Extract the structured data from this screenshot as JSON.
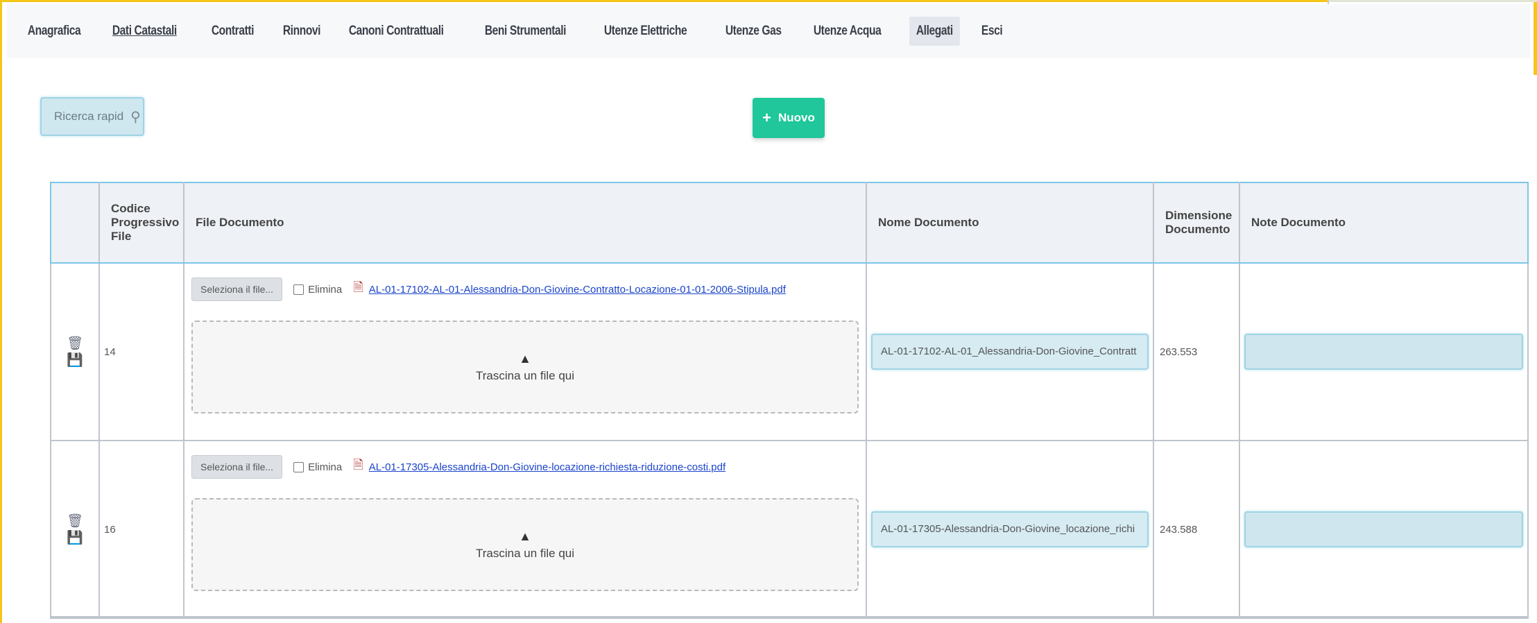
{
  "tabs": [
    {
      "label": "Anagrafica",
      "underline": false,
      "active": false
    },
    {
      "label": "Dati Catastali",
      "underline": true,
      "active": false
    },
    {
      "label": "Contratti",
      "underline": false,
      "active": false
    },
    {
      "label": "Rinnovi",
      "underline": false,
      "active": false
    },
    {
      "label": "Canoni Contrattuali",
      "underline": false,
      "active": false
    },
    {
      "label": "Beni Strumentali",
      "underline": false,
      "active": false
    },
    {
      "label": "Utenze Elettriche",
      "underline": false,
      "active": false
    },
    {
      "label": "Utenze Gas",
      "underline": false,
      "active": false
    },
    {
      "label": "Utenze Acqua",
      "underline": false,
      "active": false
    },
    {
      "label": "Allegati",
      "underline": false,
      "active": true
    },
    {
      "label": "Esci",
      "underline": false,
      "active": false
    }
  ],
  "search": {
    "placeholder": "Ricerca rapid"
  },
  "toolbar": {
    "new_label": "Nuovo"
  },
  "table": {
    "headers": [
      "",
      "Codice Progressivo File",
      "File Documento",
      "Nome Documento",
      "Dimensione Documento",
      "Note Documento"
    ],
    "rows": [
      {
        "code": "14",
        "select_label": "Seleziona il file...",
        "delete_label": "Elimina",
        "file_link": "AL-01-17102-AL-01-Alessandria-Don-Giovine-Contratto-Locazione-01-01-2006-Stipula.pdf",
        "drop_label": "Trascina un file qui",
        "name": "AL-01-17102-AL-01_Alessandria-Don-Giovine_Contratt",
        "size": "263.553",
        "note": ""
      },
      {
        "code": "16",
        "select_label": "Seleziona il file...",
        "delete_label": "Elimina",
        "file_link": "AL-01-17305-Alessandria-Don-Giovine-locazione-richiesta-riduzione-costi.pdf",
        "drop_label": "Trascina un file qui",
        "name": "AL-01-17305-Alessandria-Don-Giovine_locazione_richi",
        "size": "243.588",
        "note": ""
      }
    ]
  },
  "icons": {
    "search": "search-icon",
    "plus": "plus-icon",
    "trash": "trash-icon",
    "save": "save-icon",
    "pdf": "pdf-file-icon",
    "upload": "upload-icon"
  },
  "colors": {
    "frame": "#f5c518",
    "accent_new": "#1fc79a",
    "input_bg": "#cfe7ef",
    "link": "#1a44cc"
  }
}
